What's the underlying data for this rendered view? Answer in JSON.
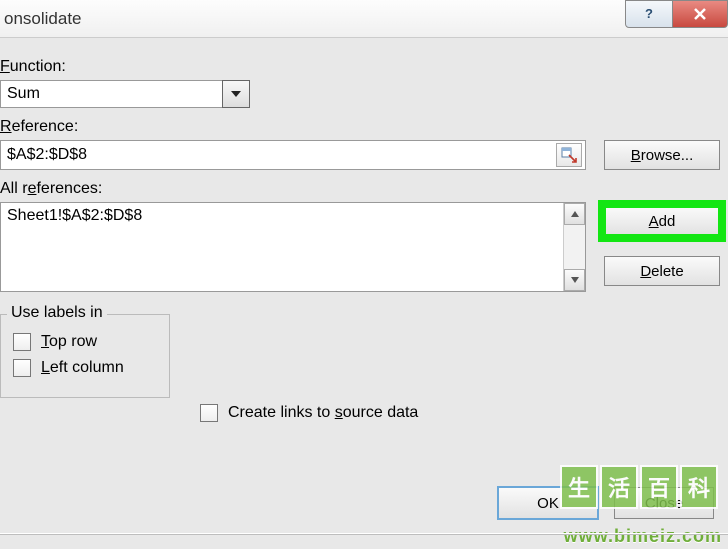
{
  "titlebar": {
    "title": "onsolidate"
  },
  "function": {
    "label": "Function:",
    "value": "Sum"
  },
  "reference": {
    "label": "Reference:",
    "value": "$A$2:$D$8"
  },
  "browse": {
    "label": "Browse..."
  },
  "all_refs": {
    "label": "All references:",
    "items": [
      "Sheet1!$A$2:$D$8"
    ]
  },
  "buttons": {
    "add": "Add",
    "delete": "Delete",
    "ok": "OK",
    "close": "Close"
  },
  "labels_group": {
    "legend": "Use labels in",
    "top_row": "Top row",
    "left_col": "Left column"
  },
  "link_check": {
    "label": "Create links to source data"
  },
  "watermark": {
    "url": "www.bimeiz.com",
    "chars": [
      "生",
      "活",
      "百",
      "科"
    ]
  }
}
